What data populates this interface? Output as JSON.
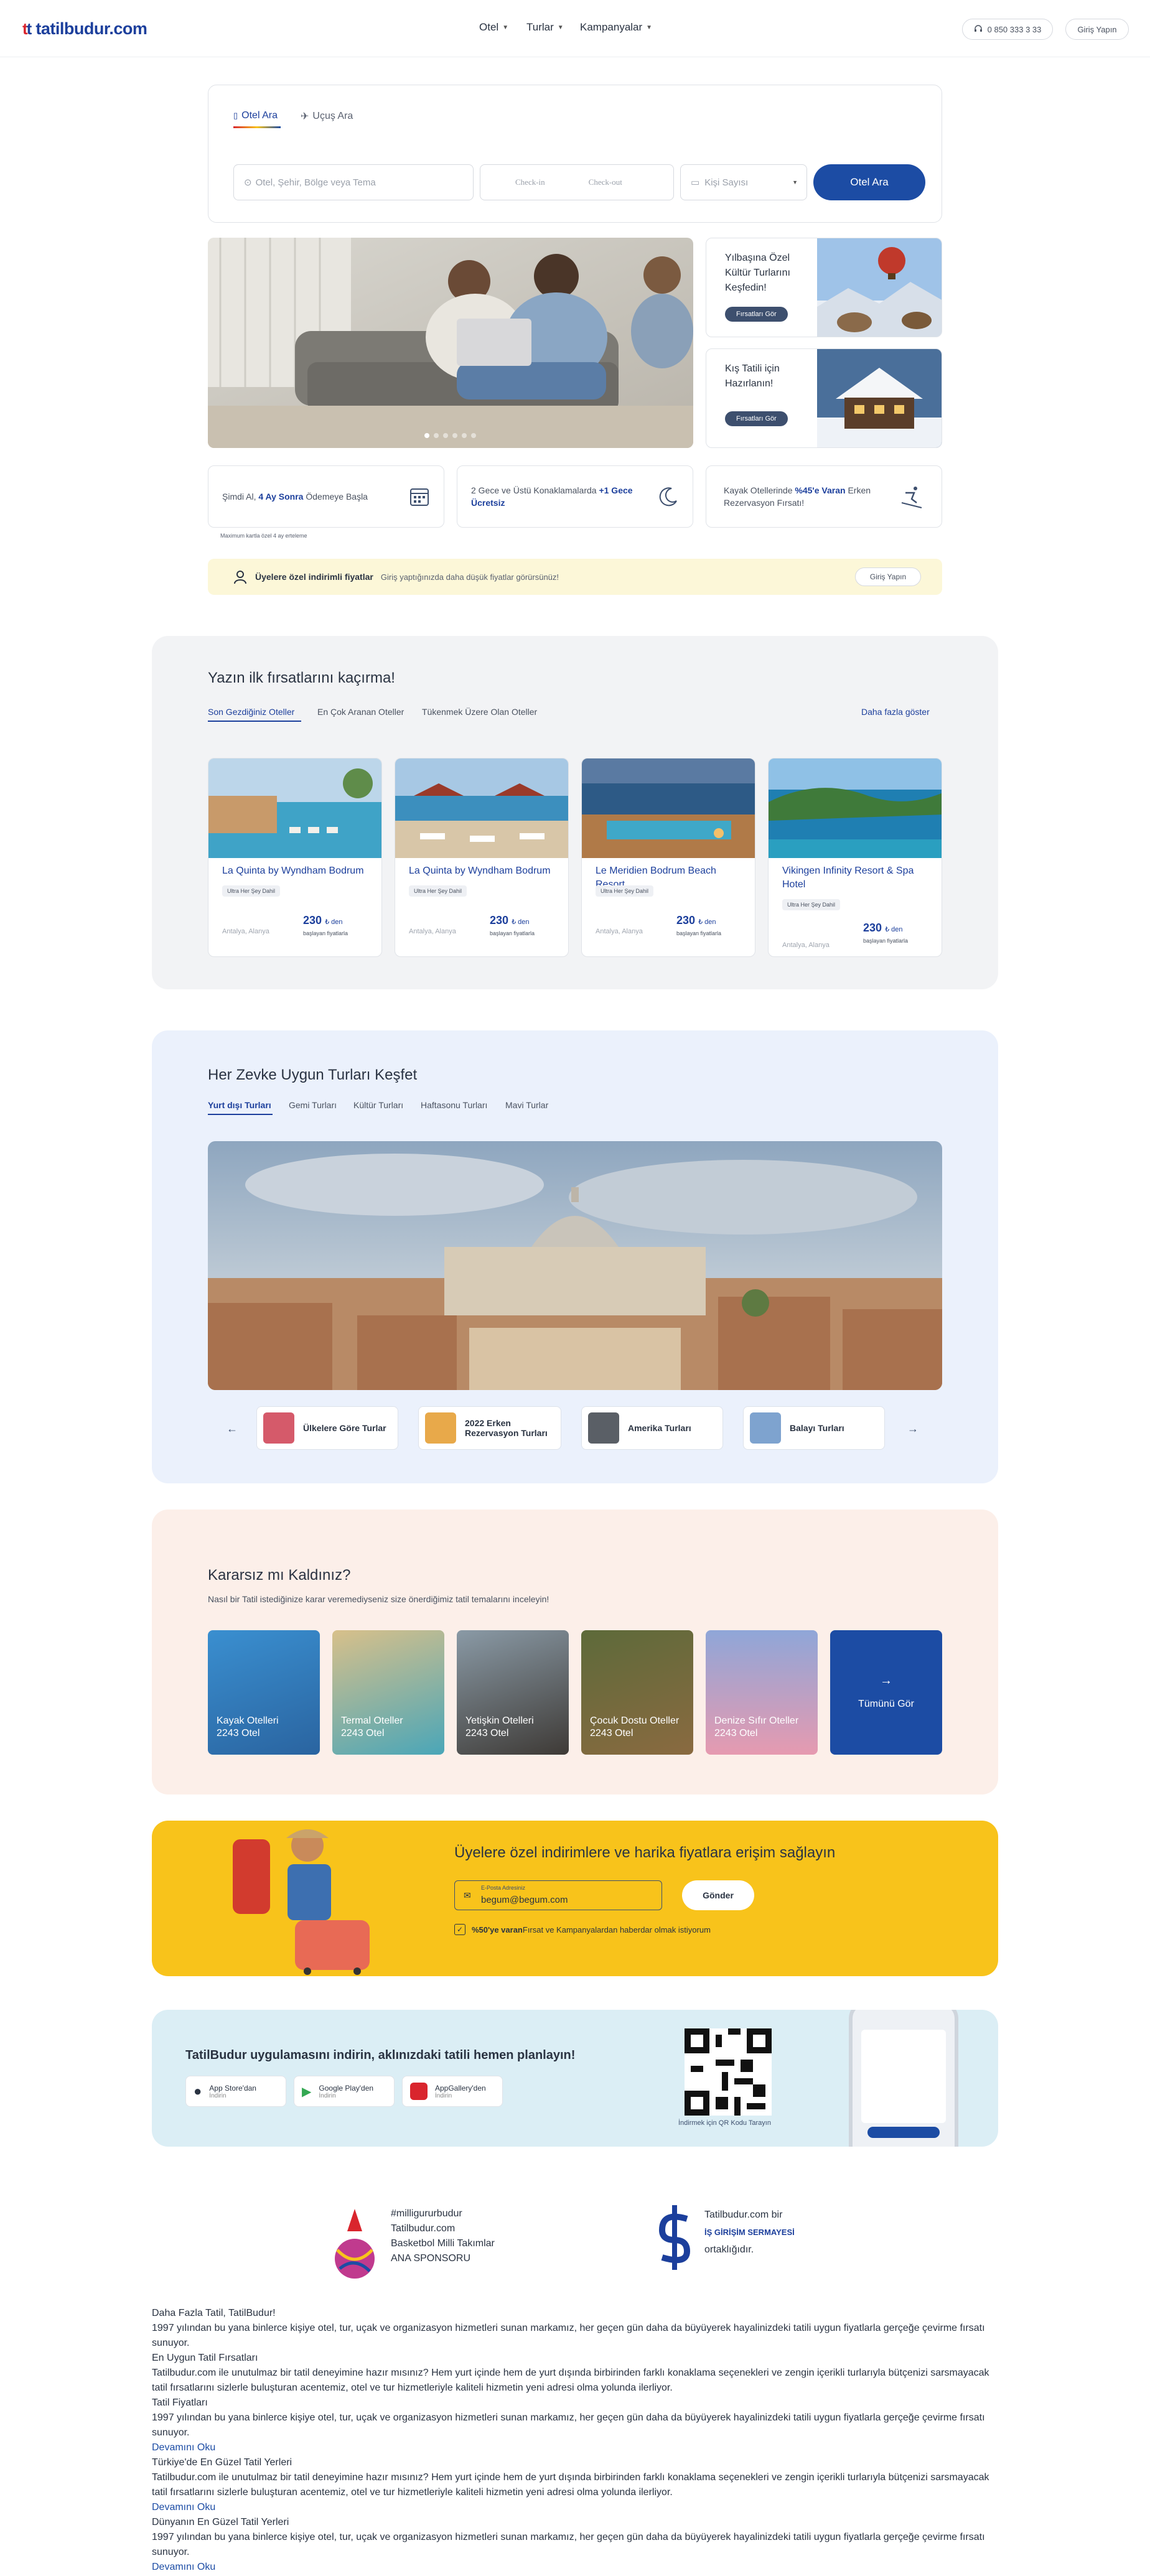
{
  "header": {
    "logo_text": "tatilbudur.com",
    "nav": [
      "Otel",
      "Turlar",
      "Kampanyalar"
    ],
    "phone": "0 850 333 3 33",
    "login": "Giriş Yapın"
  },
  "search": {
    "tabs": [
      "Otel Ara",
      "Uçuş Ara"
    ],
    "destination_placeholder": "Otel, Şehir, Bölge veya Tema",
    "checkin": "Check-in",
    "checkout": "Check-out",
    "guests": "Kişi Sayısı",
    "button": "Otel Ara"
  },
  "hero": {
    "promos": [
      {
        "title": "Yılbaşına Özel Kültür Turlarını Keşfedin!",
        "button": "Fırsatları Gör"
      },
      {
        "title": "Kış Tatili için Hazırlanın!",
        "button": "Fırsatları Gör"
      }
    ]
  },
  "info": {
    "i1_a": "Şimdi Al, ",
    "i1_b": "4 Ay Sonra",
    "i1_c": " Ödemeye Başla",
    "i1_note": "Maximum kartla özel 4 ay erteleme",
    "i2_a": "2 Gece ve Üstü Konaklamalarda ",
    "i2_b": "+1 Gece Ücretsiz",
    "i3_a": "Kayak Otellerinde ",
    "i3_b": "%45'e Varan",
    "i3_c": " Erken Rezervasyon Fırsatı!"
  },
  "member": {
    "title": "Üyelere özel indirimli fiyatlar",
    "desc": "Giriş yaptığınızda daha düşük fiyatlar görürsünüz!",
    "button": "Giriş Yapın"
  },
  "deals": {
    "title": "Yazın ilk fırsatlarını kaçırma!",
    "tabs": [
      "Son Gezdiğiniz Oteller",
      "En Çok Aranan Oteller",
      "Tükenmek Üzere Olan Oteller"
    ],
    "more": "Daha fazla göster",
    "cards": [
      {
        "name": "La Quinta by Wyndham Bodrum",
        "badge": "Ultra Her Şey Dahil",
        "location": "Antalya, Alanya",
        "price": "230",
        "cur": "₺ den",
        "sub": "başlayan fiyatlarla"
      },
      {
        "name": "La Quinta by Wyndham Bodrum",
        "badge": "Ultra Her Şey Dahil",
        "location": "Antalya, Alanya",
        "price": "230",
        "cur": "₺ den",
        "sub": "başlayan fiyatlarla"
      },
      {
        "name": "Le Meridien Bodrum Beach Resort",
        "badge": "Ultra Her Şey Dahil",
        "location": "Antalya, Alanya",
        "price": "230",
        "cur": "₺ den",
        "sub": "başlayan fiyatlarla"
      },
      {
        "name": "Vikingen Infinity Resort & Spa Hotel",
        "badge": "Ultra Her Şey Dahil",
        "location": "Antalya, Alanya",
        "price": "230",
        "cur": "₺ den",
        "sub": "başlayan fiyatlarla"
      }
    ]
  },
  "tours": {
    "title": "Her Zevke Uygun Turları Keşfet",
    "tabs": [
      "Yurt dışı Turları",
      "Gemi Turları",
      "Kültür Turları",
      "Haftasonu Turları",
      "Mavi Turlar"
    ],
    "categories": [
      "Ülkelere Göre Turlar",
      "2022 Erken Rezervasyon Turları",
      "Amerika Turları",
      "Balayı Turları"
    ]
  },
  "undecided": {
    "title": "Kararsız mı Kaldınız?",
    "desc": "Nasıl bir Tatil istediğinize karar veremediyseniz size önerdiğimiz tatil temalarını inceleyin!",
    "themes": [
      {
        "name": "Kayak Otelleri",
        "count": "2243 Otel"
      },
      {
        "name": "Termal Oteller",
        "count": "2243 Otel"
      },
      {
        "name": "Yetişkin Otelleri",
        "count": "2243 Otel"
      },
      {
        "name": "Çocuk Dostu Oteller",
        "count": "2243 Otel"
      },
      {
        "name": "Denize Sıfır Oteller",
        "count": "2243 Otel"
      }
    ],
    "all": "Tümünü Gör"
  },
  "newsletter": {
    "title": "Üyelere özel indirimlere ve harika fiyatlara erişim sağlayın",
    "email_label": "E-Posta Adresiniz",
    "email_value": "begum@begum.com",
    "button": "Gönder",
    "consent_bold": "%50'ye varan",
    "consent_rest": " Fırsat ve Kampanyalardan haberdar olmak istiyorum"
  },
  "app": {
    "title": "TatilBudur uygulamasını indirin, aklınızdaki tatili hemen planlayın!",
    "stores": [
      {
        "name": "App Store'dan",
        "sub": "İndirin"
      },
      {
        "name": "Google Play'den",
        "sub": "İndirin"
      },
      {
        "name": "AppGallery'den",
        "sub": "İndirin"
      }
    ],
    "qr_label": "İndirmek için QR Kodu Tarayın"
  },
  "sponsor": {
    "basket": [
      "#milligururbudur",
      "Tatilbudur.com",
      "Basketbol Milli Takımlar",
      "ANA SPONSORU"
    ],
    "is_a": "Tatilbudur.com bir",
    "is_b": "İŞ GİRİŞİM SERMAYESİ",
    "is_c": "ortaklığıdır."
  },
  "seo": {
    "l1": "Daha Fazla Tatil, TatilBudur!",
    "p1": "1997 yılından bu yana binlerce kişiye otel, tur, uçak ve organizasyon hizmetleri sunan markamız, her geçen gün daha da büyüyerek hayalinizdeki tatili uygun fiyatlarla gerçeğe çevirme fırsatı sunuyor.",
    "l2": "En Uygun Tatil Fırsatları",
    "p2": "Tatilbudur.com ile unutulmaz bir tatil deneyimine hazır mısınız? Hem yurt içinde hem de yurt dışında birbirinden farklı konaklama seçenekleri ve zengin içerikli turlarıyla bütçenizi sarsmayacak tatil fırsatlarını sizlerle buluşturan acentemiz, otel ve tur hizmetleriyle kaliteli hizmetin yeni adresi olma yolunda ilerliyor.",
    "l3": "Tatil Fiyatları",
    "p3": "1997 yılından bu yana binlerce kişiye otel, tur, uçak ve organizasyon hizmetleri sunan markamız, her geçen gün daha da büyüyerek hayalinizdeki tatili uygun fiyatlarla gerçeğe çevirme fırsatı sunuyor.",
    "more1": "Devamını Oku",
    "l4": "Türkiye'de En Güzel Tatil Yerleri",
    "p4": "Tatilbudur.com ile unutulmaz bir tatil deneyimine hazır mısınız? Hem yurt içinde hem de yurt dışında birbirinden farklı konaklama seçenekleri ve zengin içerikli turlarıyla bütçenizi sarsmayacak tatil fırsatlarını sizlerle buluşturan acentemiz, otel ve tur hizmetleriyle kaliteli hizmetin yeni adresi olma yolunda ilerliyor.",
    "more2": "Devamını Oku",
    "l5": "Dünyanın En Güzel Tatil Yerleri",
    "p5": "1997 yılından bu yana binlerce kişiye otel, tur, uçak ve organizasyon hizmetleri sunan markamız, her geçen gün daha da büyüyerek hayalinizdeki tatili uygun fiyatlarla gerçeğe çevirme fırsatı sunuyor.",
    "more3": "Devamını Oku"
  },
  "colors": {
    "brand_blue": "#1c4ca4",
    "brand_red": "#d9252d",
    "yellow": "#f8c31b"
  }
}
